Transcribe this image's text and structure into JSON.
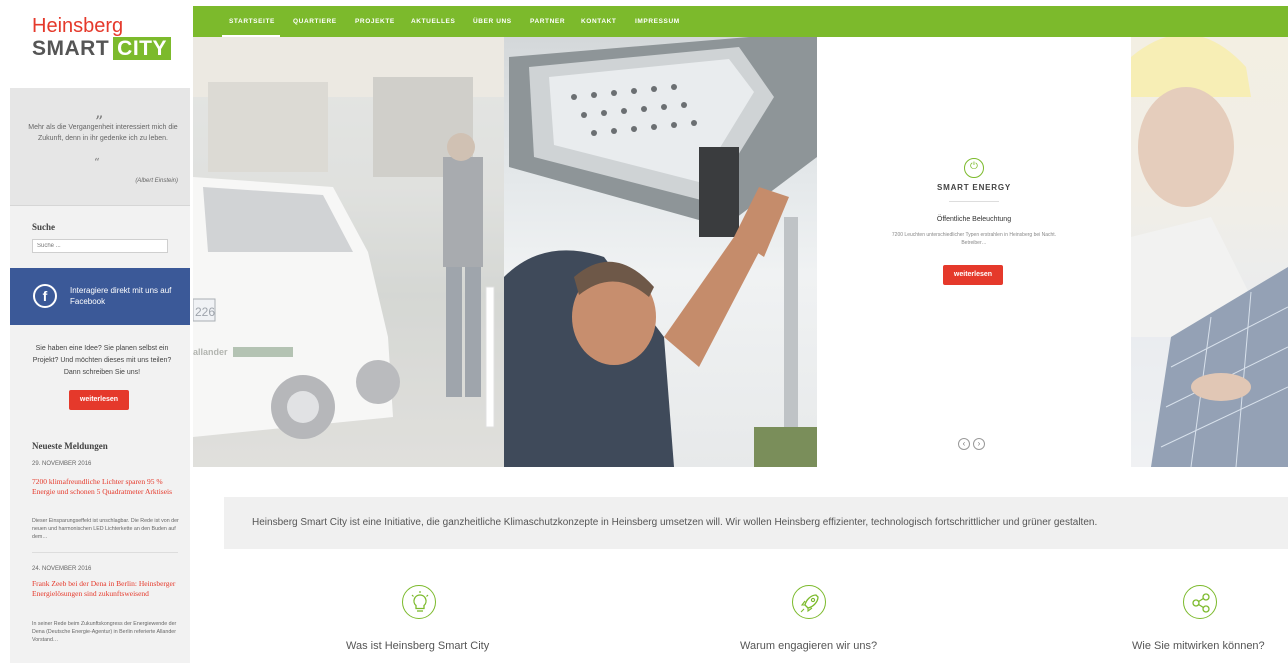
{
  "logo": {
    "line1": "Heinsberg",
    "line2_a": "SMART",
    "line2_b": "CITY"
  },
  "quote": {
    "open": "”",
    "text": "Mehr als die Vergangenheit interessiert mich die Zukunft, denn in ihr gedenke ich zu leben.",
    "close": "“",
    "author": "(Albert Einstein)"
  },
  "search": {
    "heading": "Suche",
    "placeholder": "Suche ..."
  },
  "facebook": {
    "icon": "facebook-icon",
    "text": "Interagiere direkt mit uns auf Facebook"
  },
  "idea": {
    "text": "Sie haben eine Idee? Sie planen selbst ein Projekt? Und möchten dieses mit uns teilen? Dann schreiben Sie uns!",
    "button": "weiterlesen"
  },
  "news": {
    "heading": "Neueste Meldungen",
    "items": [
      {
        "date": "29. NOVEMBER 2016",
        "title": "7200 klimafreundliche Lichter sparen 95 % Energie und schonen 5 Quadratmeter Arktiseis",
        "excerpt": "Dieser Einsparungseffekt ist unschlagbar. Die Rede ist von der neuen und harmonischen LED Lichterkette an den Buden auf dem…"
      },
      {
        "date": "24. NOVEMBER 2016",
        "title": "Frank Zeeb bei der Dena in Berlin: Heinsberger Energielösungen sind zukunftsweisend",
        "excerpt": "In seiner Rede beim Zukunftskongress der Energiewende der Dena (Deutsche Energie-Agentur) in Berlin referierte Allander Vorstand…"
      }
    ]
  },
  "nav": {
    "items": [
      "STARTSEITE",
      "QUARTIERE",
      "PROJEKTE",
      "AKTUELLES",
      "ÜBER UNS",
      "PARTNER",
      "KONTAKT",
      "IMPRESSUM"
    ]
  },
  "slider": {
    "icon": "plug-icon",
    "title": "SMART ENERGY",
    "subtitle": "Öffentliche Beleuchtung",
    "excerpt": "7200 Leuchten unterschiedlicher Typen erstrahlen in Heinsberg bei Nacht. Betreiber…",
    "button": "weiterlesen",
    "prev": "‹",
    "next": "›",
    "car_plate": "226",
    "car_sticker": "allander"
  },
  "intro": {
    "text": "Heinsberg Smart City ist eine Initiative, die ganzheitliche Klimaschutzkonzepte in Heinsberg umsetzen will. Wir wollen Heinsberg effizienter, technologisch fortschrittlicher und grüner gestalten."
  },
  "features": [
    {
      "icon": "lightbulb-icon",
      "title": "Was ist Heinsberg Smart City"
    },
    {
      "icon": "rocket-icon",
      "title": "Warum engagieren wir uns?"
    },
    {
      "icon": "share-icon",
      "title": "Wie Sie mitwirken können?"
    }
  ],
  "colors": {
    "green": "#7cba2c",
    "red": "#e5392b",
    "facebook": "#3b5998"
  }
}
